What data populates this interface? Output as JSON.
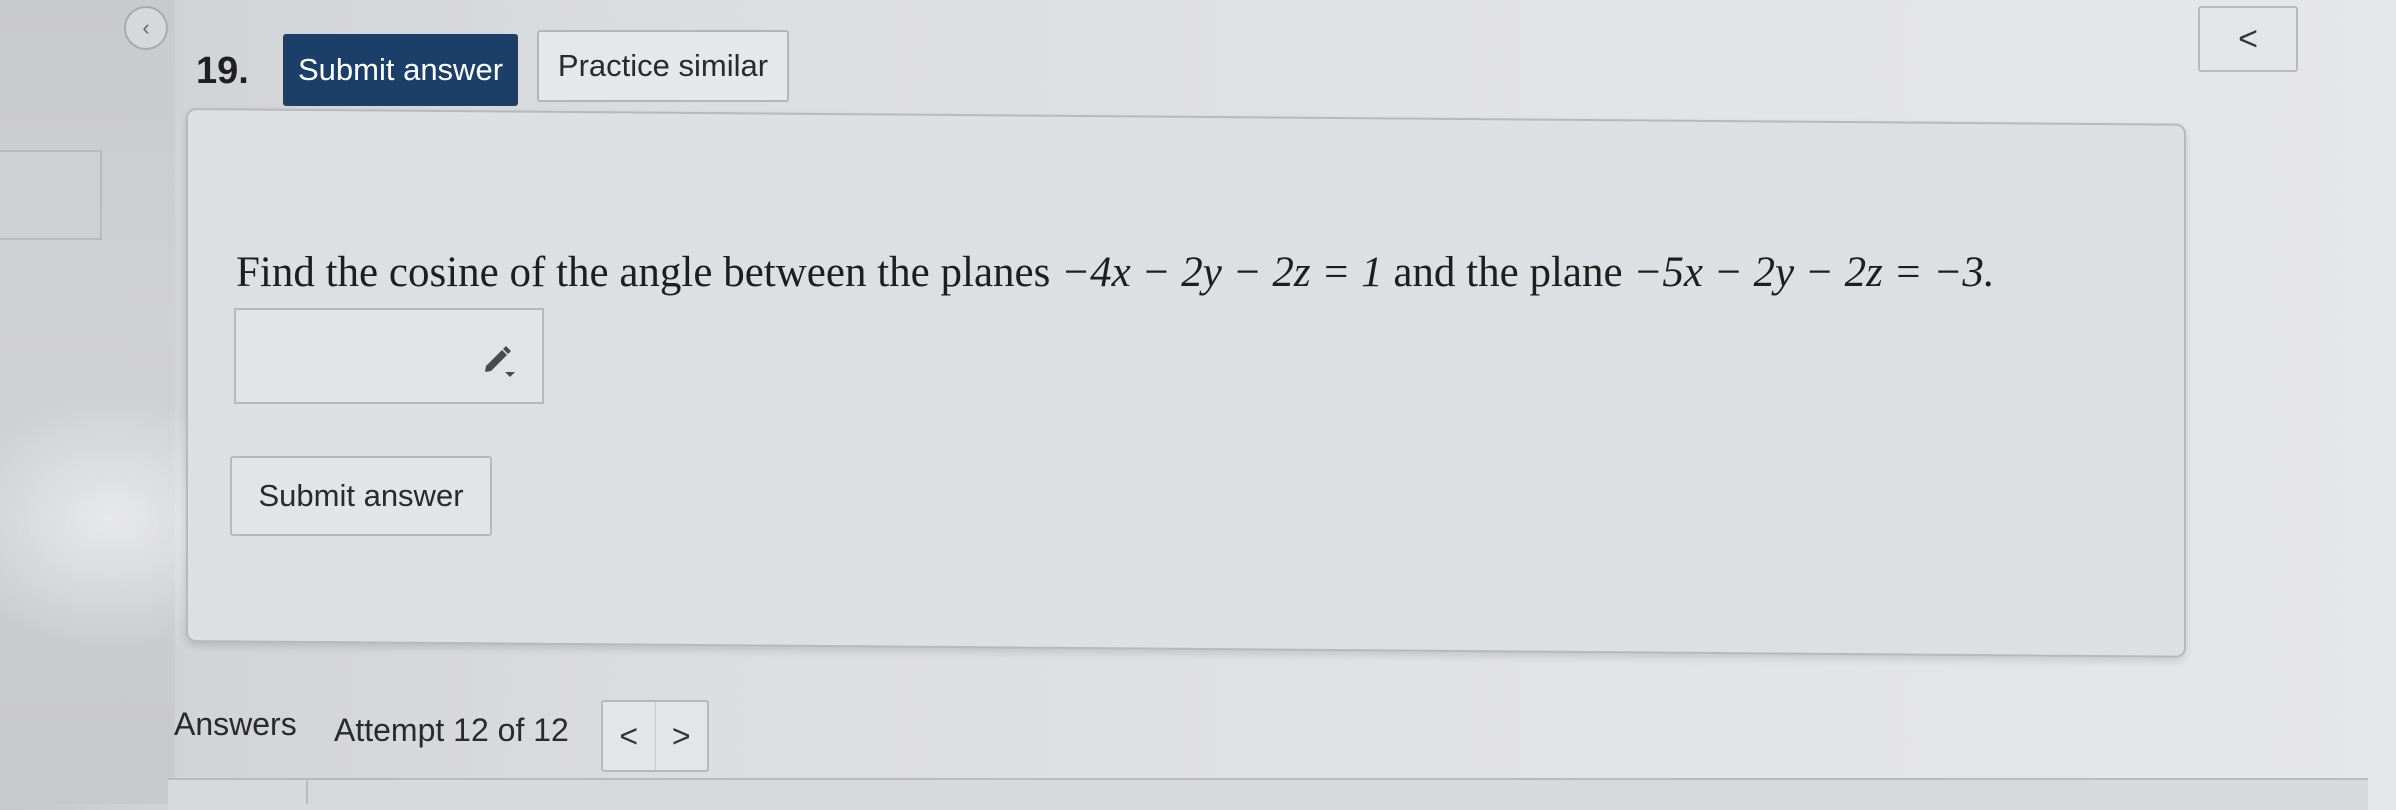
{
  "nav": {
    "back_glyph": "‹",
    "collapse_glyph": "<"
  },
  "question": {
    "number": "19.",
    "text_prefix": "Find the cosine of the angle between the planes",
    "plane1": "−4x − 2y − 2z = 1",
    "text_middle": "and the plane",
    "plane2": "−5x − 2y − 2z = −3."
  },
  "toolbar": {
    "submit_label": "Submit answer",
    "practice_label": "Practice similar"
  },
  "answer": {
    "value": "",
    "edit_icon": "pencil-icon"
  },
  "form": {
    "submit_label": "Submit answer"
  },
  "answers": {
    "label": "Answers",
    "attempt": "Attempt 12 of 12",
    "prev_glyph": "<",
    "next_glyph": ">"
  },
  "colors": {
    "primary_button": "#1c3f6a"
  }
}
